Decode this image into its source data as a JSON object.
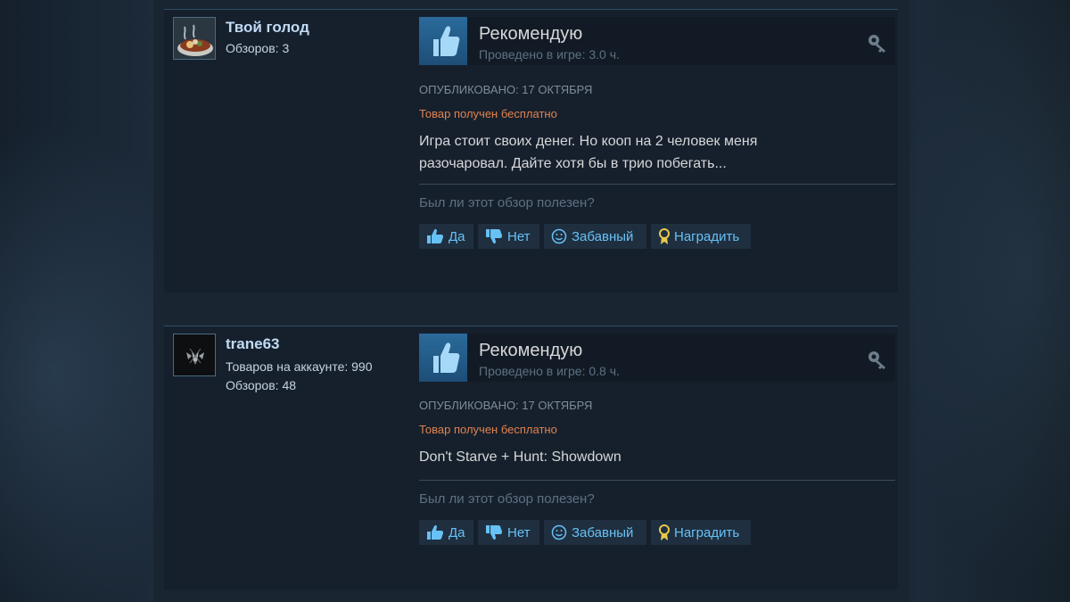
{
  "reviews": [
    {
      "author": "Твой голод",
      "meta_lines": [
        "Обзоров: 3"
      ],
      "verdict": "Рекомендую",
      "hours": "Проведено в игре: 3.0 ч.",
      "posted": "ОПУБЛИКОВАНО: 17 ОКТЯБРЯ",
      "free_label": "Товар получен бесплатно",
      "content_lines": [
        "Игра стоит своих денег. Но кооп на 2 человек меня",
        "разочаровал. Дайте хотя бы в трио побегать..."
      ],
      "helpful_prompt": "Был ли этот обзор полезен?",
      "buttons": {
        "yes": "Да",
        "no": "Нет",
        "funny": "Забавный",
        "award": "Наградить"
      }
    },
    {
      "author": "trane63",
      "meta_lines": [
        "Товаров на аккаунте: 990",
        "Обзоров: 48"
      ],
      "verdict": "Рекомендую",
      "hours": "Проведено в игре: 0.8 ч.",
      "posted": "ОПУБЛИКОВАНО: 17 ОКТЯБРЯ",
      "free_label": "Товар получен бесплатно",
      "content_lines": [
        "Don't Starve + Hunt: Showdown"
      ],
      "helpful_prompt": "Был ли этот обзор полезен?",
      "buttons": {
        "yes": "Да",
        "no": "Нет",
        "funny": "Забавный",
        "award": "Наградить"
      }
    }
  ],
  "colors": {
    "accent_blue": "#67c1f5",
    "free_orange": "#e0824d",
    "thumb_blue": "#2a6a9a",
    "background": "#1b2838"
  }
}
